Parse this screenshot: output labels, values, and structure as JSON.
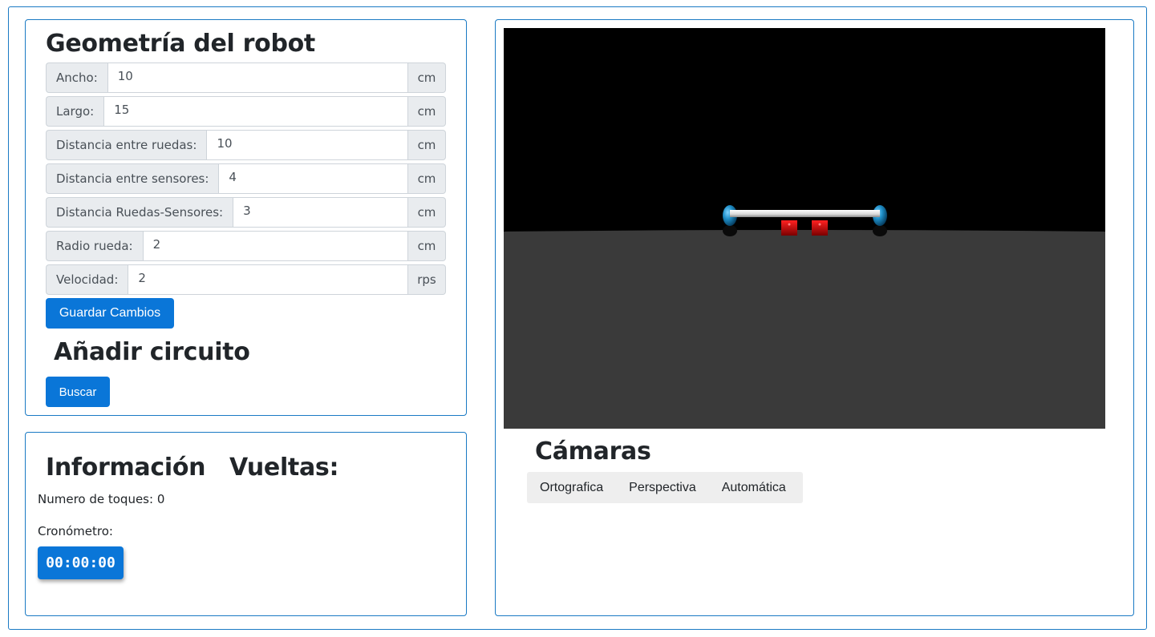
{
  "geometry": {
    "title": "Geometría del robot",
    "rows": [
      {
        "label": "Ancho:",
        "value": "10",
        "unit": "cm"
      },
      {
        "label": "Largo:",
        "value": "15",
        "unit": "cm"
      },
      {
        "label": "Distancia entre ruedas:",
        "value": "10",
        "unit": "cm"
      },
      {
        "label": "Distancia entre sensores:",
        "value": "4",
        "unit": "cm"
      },
      {
        "label": "Distancia Ruedas-Sensores:",
        "value": "3",
        "unit": "cm"
      },
      {
        "label": "Radio rueda:",
        "value": "2",
        "unit": "cm"
      },
      {
        "label": "Velocidad:",
        "value": "2",
        "unit": "rps"
      }
    ],
    "save_label": "Guardar Cambios"
  },
  "circuit": {
    "title": "Añadir circuito",
    "search_label": "Buscar"
  },
  "info": {
    "title": "Información",
    "laps_title": "Vueltas:",
    "touches_text": "Numero de toques: 0",
    "chrono_label": "Cronómetro:",
    "chrono_value": "00:00:00"
  },
  "cameras": {
    "title": "Cámaras",
    "options": [
      "Ortografica",
      "Perspectiva",
      "Automática"
    ]
  },
  "colors": {
    "accent": "#0a76d8",
    "border": "#1a7ac4",
    "sky": "#000000",
    "floor": "#3a3a3a",
    "wheel": "#2a9fd6",
    "sensor": "#e00000"
  }
}
